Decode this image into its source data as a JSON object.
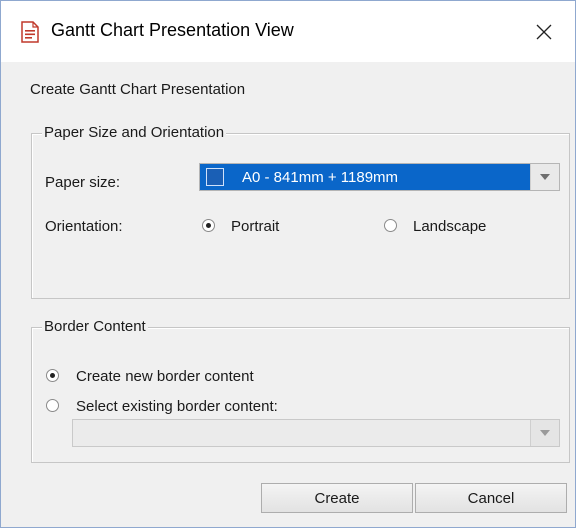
{
  "window": {
    "title": "Gantt Chart Presentation View"
  },
  "heading": "Create Gantt Chart Presentation",
  "paper_group": {
    "legend": "Paper Size and Orientation",
    "paper_size_label": "Paper size:",
    "paper_size_value": "A0 - 841mm + 1189mm",
    "orientation_label": "Orientation:",
    "orientation_options": [
      {
        "label": "Portrait",
        "checked": true
      },
      {
        "label": "Landscape",
        "checked": false
      }
    ]
  },
  "border_group": {
    "legend": "Border Content",
    "options": [
      {
        "label": "Create new border content",
        "checked": true
      },
      {
        "label": "Select existing border content:",
        "checked": false
      }
    ],
    "existing_value": ""
  },
  "buttons": {
    "create": "Create",
    "cancel": "Cancel"
  }
}
